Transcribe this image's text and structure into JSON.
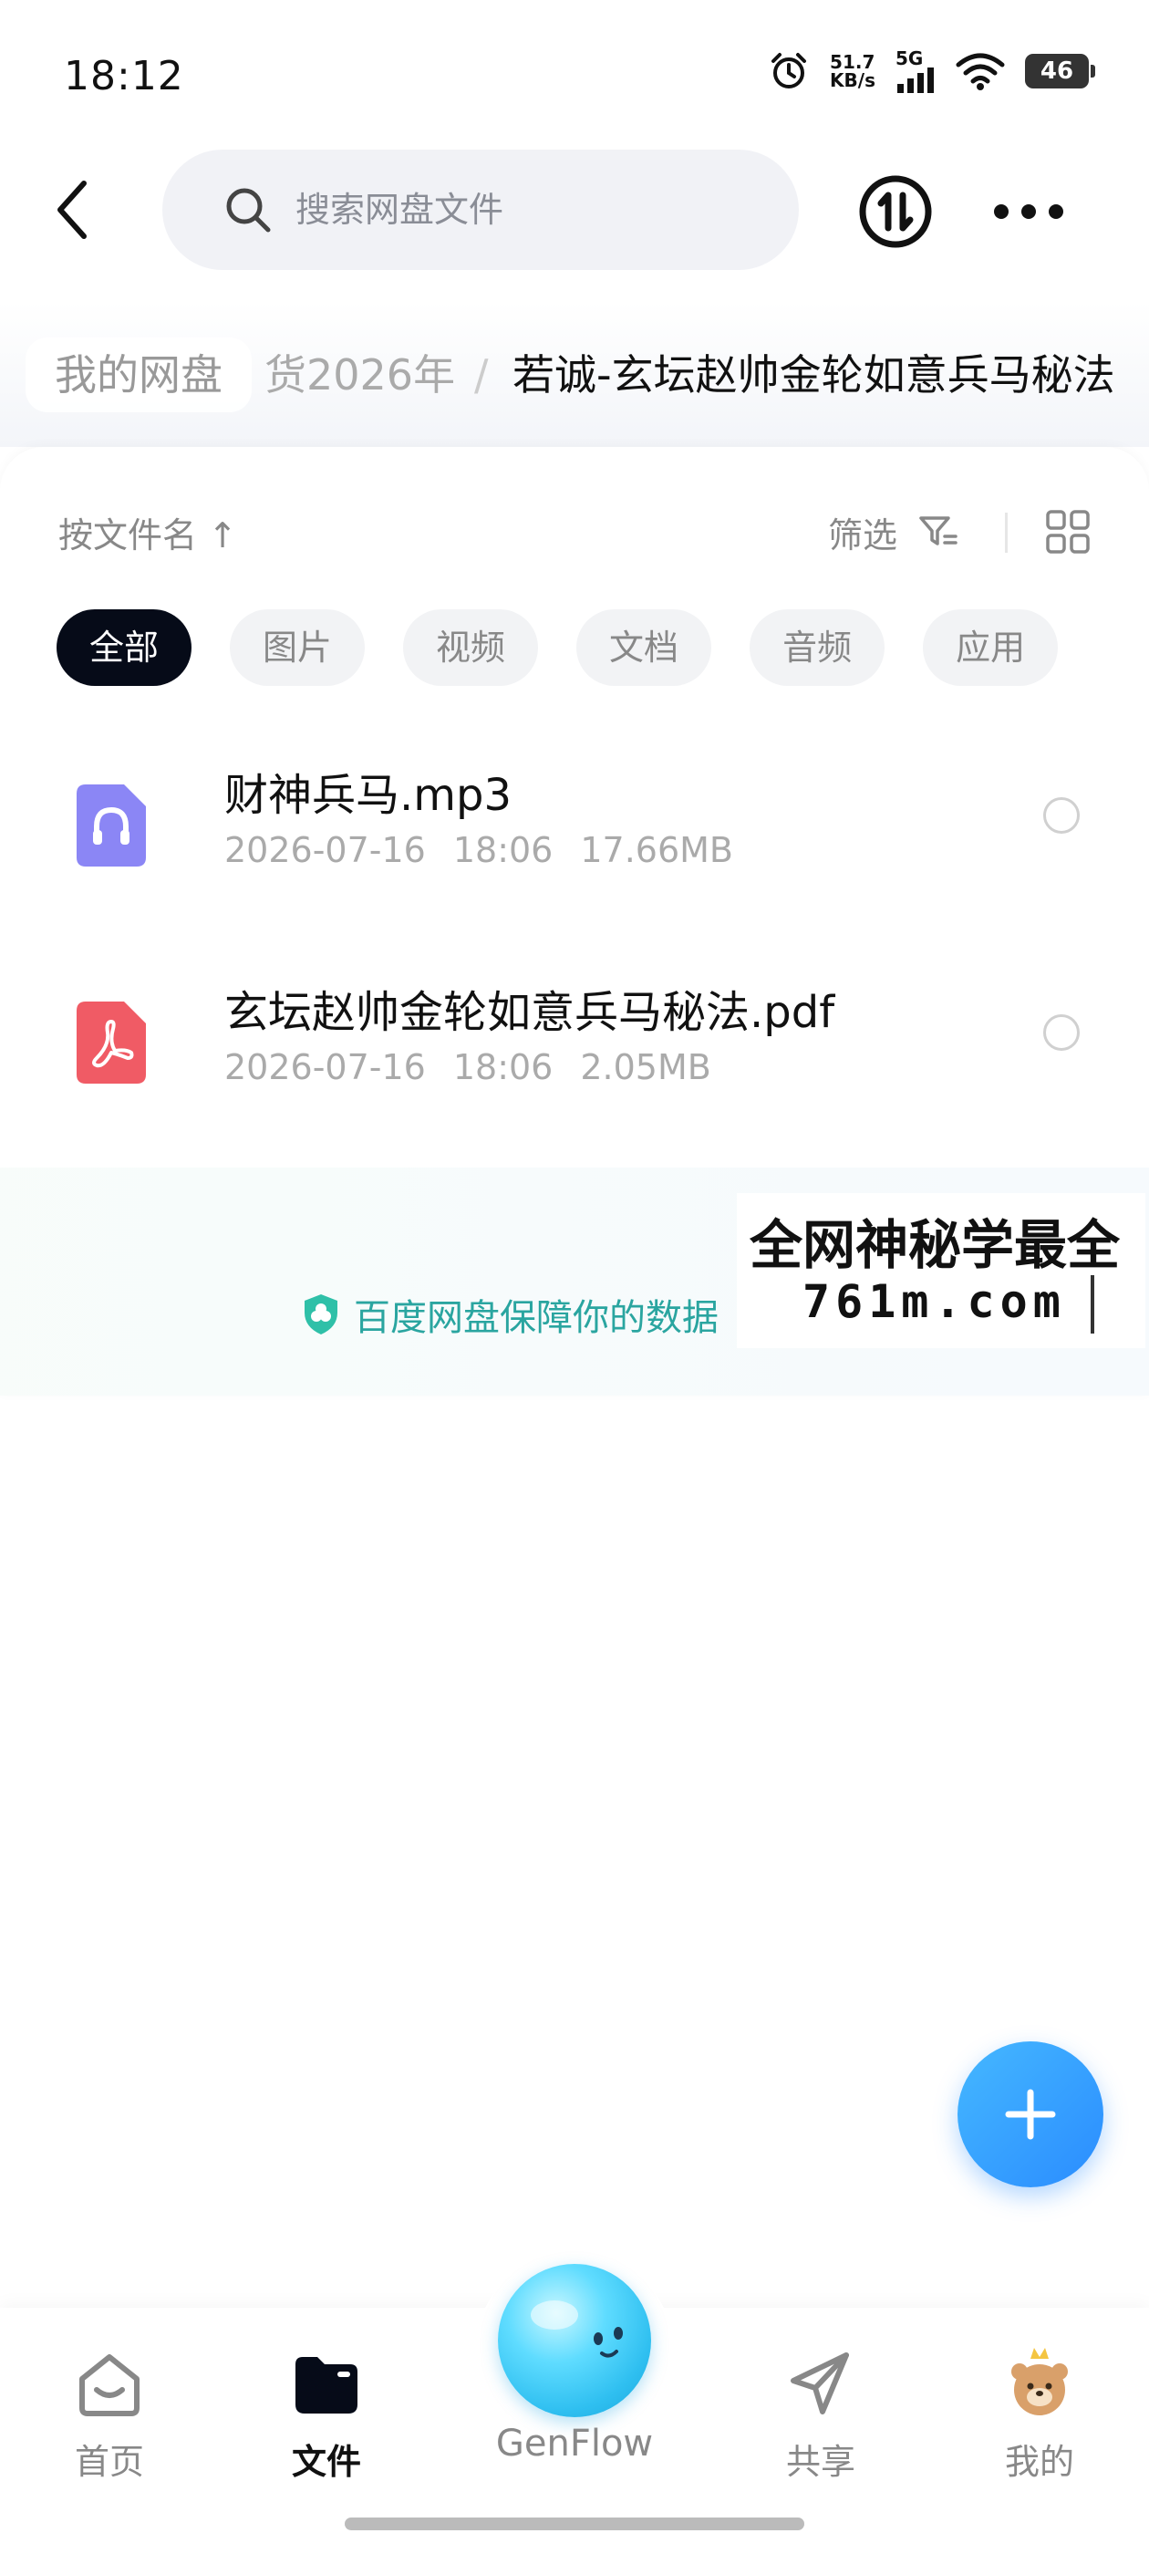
{
  "status_bar": {
    "time": "18:12",
    "speed_value": "51.7",
    "speed_unit": "KB/s",
    "network": "5G",
    "battery": "46"
  },
  "header": {
    "search_placeholder": "搜索网盘文件"
  },
  "breadcrumb": {
    "home": "我的网盘",
    "middle": "货2026年",
    "separator": "/",
    "current": "若诚-玄坛赵帅金轮如意兵马秘法"
  },
  "toolbar": {
    "sort_label": "按文件名",
    "sort_arrow": "↑",
    "filter_label": "筛选"
  },
  "chips": [
    {
      "label": "全部",
      "active": true
    },
    {
      "label": "图片",
      "active": false
    },
    {
      "label": "视频",
      "active": false
    },
    {
      "label": "文档",
      "active": false
    },
    {
      "label": "音频",
      "active": false
    },
    {
      "label": "应用",
      "active": false
    }
  ],
  "files": [
    {
      "name": "财神兵马.mp3",
      "date": "2026-07-16",
      "time": "18:06",
      "size": "17.66MB",
      "type_icon": "audio-file-icon",
      "color": "#8b86f5"
    },
    {
      "name": "玄坛赵帅金轮如意兵马秘法.pdf",
      "date": "2026-07-16",
      "time": "18:06",
      "size": "2.05MB",
      "type_icon": "pdf-file-icon",
      "color": "#f05b65"
    }
  ],
  "safe_note": "百度网盘保障你的数据",
  "watermark": {
    "line1": "全网神秘学最全",
    "line2": "761m.com"
  },
  "bottom_nav": {
    "home": "首页",
    "files": "文件",
    "genflow": "GenFlow",
    "share": "共享",
    "mine": "我的"
  },
  "colors": {
    "accent": "#2a8cff",
    "active_chip": "#060b18",
    "safe_text": "#2aa5a0"
  }
}
